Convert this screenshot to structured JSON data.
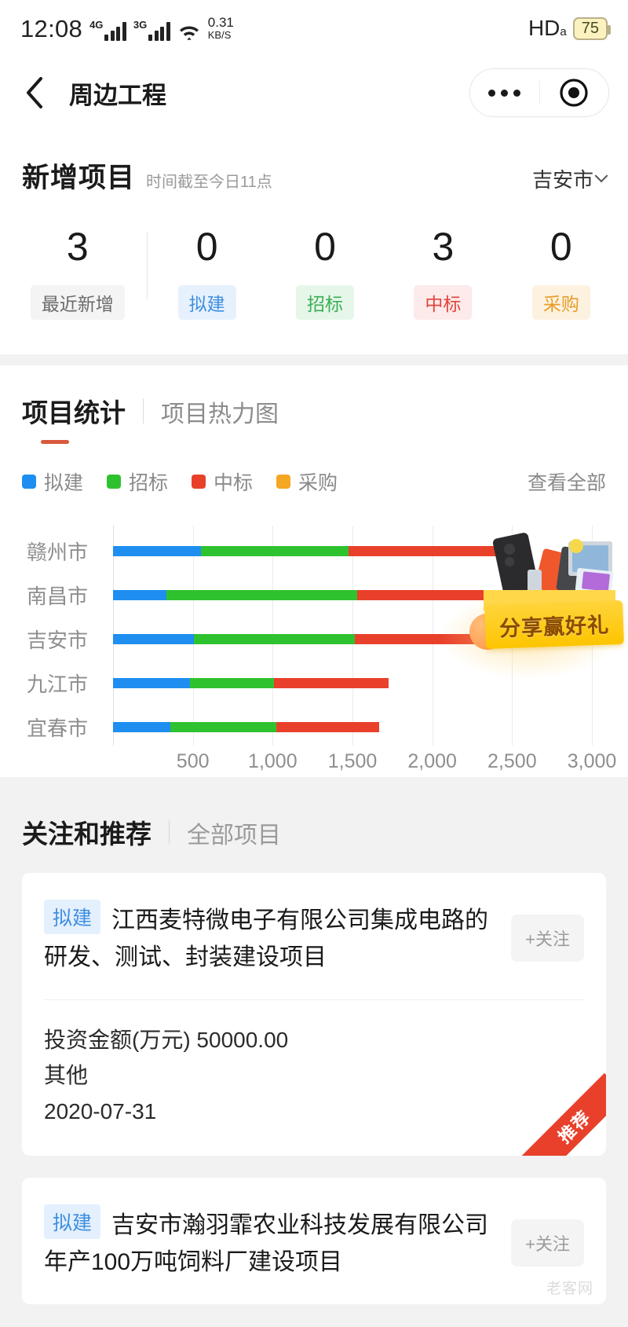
{
  "statusbar": {
    "time": "12:08",
    "net1": "4G",
    "net2": "3G",
    "speed_value": "0.31",
    "speed_unit": "KB/S",
    "hd": "HD",
    "hd_sub": "a",
    "battery": "75"
  },
  "nav": {
    "back_icon": "chevron-left-icon",
    "title": "周边工程",
    "more_icon": "more-dots-icon",
    "target_icon": "target-icon"
  },
  "stats": {
    "title": "新增项目",
    "subtitle": "时间截至今日11点",
    "city": "吉安市",
    "chevron_icon": "chevron-down-icon",
    "items": [
      {
        "value": "3",
        "label": "最近新增",
        "bg": "#f4f4f4",
        "color": "#6b6b6b"
      },
      {
        "value": "0",
        "label": "拟建",
        "bg": "#e7f1fd",
        "color": "#3e8ee0"
      },
      {
        "value": "0",
        "label": "招标",
        "bg": "#e6f7e9",
        "color": "#3bae55"
      },
      {
        "value": "3",
        "label": "中标",
        "bg": "#fdeaea",
        "color": "#e0453c"
      },
      {
        "value": "0",
        "label": "采购",
        "bg": "#fdf2e0",
        "color": "#e89d28"
      }
    ]
  },
  "chart_section": {
    "tab_active": "项目统计",
    "tab_inactive": "项目热力图",
    "view_all": "查看全部",
    "accent": "#d9593c"
  },
  "chart_data": {
    "type": "bar",
    "orientation": "horizontal",
    "stacked": true,
    "title": "项目统计",
    "xlabel": "",
    "ylabel": "",
    "categories": [
      "赣州市",
      "南昌市",
      "吉安市",
      "九江市",
      "宜春市"
    ],
    "series": [
      {
        "name": "拟建",
        "color": "#1f8ef1",
        "values": [
          550,
          335,
          505,
          480,
          360
        ]
      },
      {
        "name": "招标",
        "color": "#2fc22f",
        "values": [
          925,
          1195,
          1010,
          530,
          665
        ]
      },
      {
        "name": "中标",
        "color": "#e8402a",
        "values": [
          1135,
          1065,
          865,
          715,
          640
        ]
      },
      {
        "name": "采购",
        "color": "#f5a623",
        "values": [
          0,
          0,
          0,
          0,
          0
        ]
      }
    ],
    "totals": [
      2610,
      2595,
      2380,
      1725,
      1665
    ],
    "xticks": [
      "500",
      "1,000",
      "1,500",
      "2,000",
      "2,500",
      "3,000"
    ],
    "xtick_values": [
      500,
      1000,
      1500,
      2000,
      2500,
      3000
    ],
    "xlim": [
      0,
      3000
    ],
    "grid": true,
    "legend_position": "top-left"
  },
  "share_badge": {
    "text": "分享赢好礼",
    "icon": "gift-box-icon"
  },
  "recommend": {
    "title": "关注和推荐",
    "tab": "全部项目",
    "cards": [
      {
        "badge": "拟建",
        "title": "江西麦特微电子有限公司集成电路的研发、测试、封装建设项目",
        "follow": "+关注",
        "amount": "投资金额(万元) 50000.00",
        "category": "其他",
        "date": "2020-07-31",
        "ribbon": "推荐"
      },
      {
        "badge": "拟建",
        "title": "吉安市瀚羽霏农业科技发展有限公司年产100万吨饲料厂建设项目",
        "follow": "+关注",
        "watermark": "老客网"
      }
    ]
  }
}
